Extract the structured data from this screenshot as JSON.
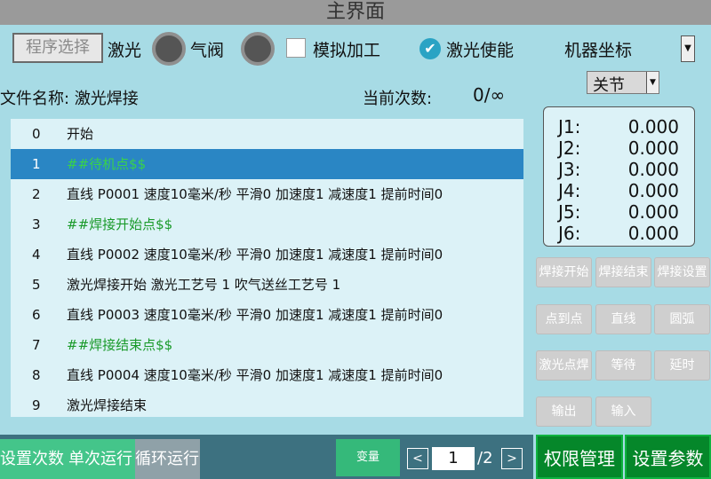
{
  "window": {
    "title": "主界面"
  },
  "topbar": {
    "program_select": "程序选择",
    "laser_label": "激光",
    "valve_label": "气阀",
    "simulate_label": "模拟加工",
    "laser_enable_label": "激光使能",
    "coord_system": "机器坐标"
  },
  "joint_select": {
    "value": "关节"
  },
  "file_info": {
    "name_label": "文件名称:",
    "name_value": "激光焊接",
    "count_label": "当前次数:",
    "count_value": "0/∞"
  },
  "program": {
    "rows": [
      {
        "num": "0",
        "text": "开始"
      },
      {
        "num": "1",
        "text": "##待机点$$"
      },
      {
        "num": "2",
        "text": "直线 P0001 速度10毫米/秒 平滑0 加速度1 减速度1 提前时间0"
      },
      {
        "num": "3",
        "text": "##焊接开始点$$"
      },
      {
        "num": "4",
        "text": "直线 P0002 速度10毫米/秒 平滑0 加速度1 减速度1 提前时间0"
      },
      {
        "num": "5",
        "text": "激光焊接开始 激光工艺号 1 吹气送丝工艺号 1"
      },
      {
        "num": "6",
        "text": "直线 P0003 速度10毫米/秒 平滑0 加速度1 减速度1 提前时间0"
      },
      {
        "num": "7",
        "text": "##焊接结束点$$"
      },
      {
        "num": "8",
        "text": "直线 P0004 速度10毫米/秒 平滑0 加速度1 减速度1 提前时间0"
      },
      {
        "num": "9",
        "text": "激光焊接结束"
      }
    ]
  },
  "coords": [
    {
      "label": "J1:",
      "value": "0.000"
    },
    {
      "label": "J2:",
      "value": "0.000"
    },
    {
      "label": "J3:",
      "value": "0.000"
    },
    {
      "label": "J4:",
      "value": "0.000"
    },
    {
      "label": "J5:",
      "value": "0.000"
    },
    {
      "label": "J6:",
      "value": "0.000"
    }
  ],
  "functions": {
    "weld_start": "焊接开始",
    "weld_end": "焊接结束",
    "weld_settings": "焊接设置",
    "point_to_point": "点到点",
    "line": "直线",
    "arc": "圆弧",
    "laser_spot_weld": "激光点焊",
    "wait": "等待",
    "delay": "延时",
    "output": "输出",
    "input": "输入"
  },
  "bottom": {
    "set_count": "设置次数",
    "single_run": "单次运行",
    "loop_run": "循环运行",
    "variable": "变量",
    "prev": "<",
    "page": "1",
    "total_pages": "/2",
    "next": ">",
    "permission": "权限管理",
    "set_params": "设置参数"
  }
}
